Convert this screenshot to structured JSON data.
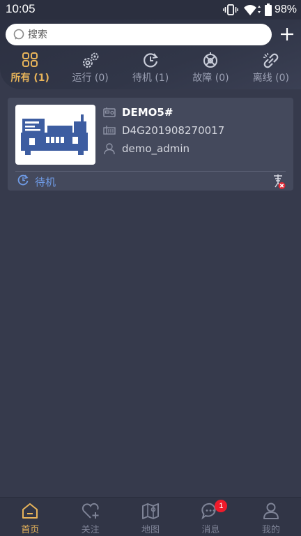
{
  "status_bar": {
    "time": "10:05",
    "battery": "98%",
    "icons": [
      "vibrate-icon",
      "wifi-icon",
      "battery-icon"
    ]
  },
  "search": {
    "placeholder": "搜索",
    "value": ""
  },
  "header": {
    "add_icon": "plus-icon"
  },
  "filter_tabs": [
    {
      "label": "所有 (1)",
      "icon": "all-grid-icon",
      "active": true
    },
    {
      "label": "运行 (0)",
      "icon": "gears-icon",
      "active": false
    },
    {
      "label": "待机 (1)",
      "icon": "standby-clock-icon",
      "active": false
    },
    {
      "label": "故障 (0)",
      "icon": "fault-wheel-icon",
      "active": false
    },
    {
      "label": "离线 (0)",
      "icon": "link-broken-icon",
      "active": false
    }
  ],
  "device": {
    "name": "DEMO5#",
    "serial": "D4G201908270017",
    "owner": "demo_admin",
    "status": "待机",
    "image_icon": "generator-icon"
  },
  "bottom_nav": [
    {
      "label": "首页",
      "icon": "home-icon",
      "active": true
    },
    {
      "label": "关注",
      "icon": "heart-plus-icon",
      "active": false
    },
    {
      "label": "地图",
      "icon": "map-icon",
      "active": false
    },
    {
      "label": "消息",
      "icon": "message-icon",
      "active": false,
      "badge": "1"
    },
    {
      "label": "我的",
      "icon": "user-icon",
      "active": false
    }
  ],
  "colors": {
    "background": "#363a4c",
    "accent": "#e8b45a",
    "status_blue": "#6f9be6",
    "badge_red": "#f01b2b",
    "generator_blue": "#3d5da1"
  }
}
